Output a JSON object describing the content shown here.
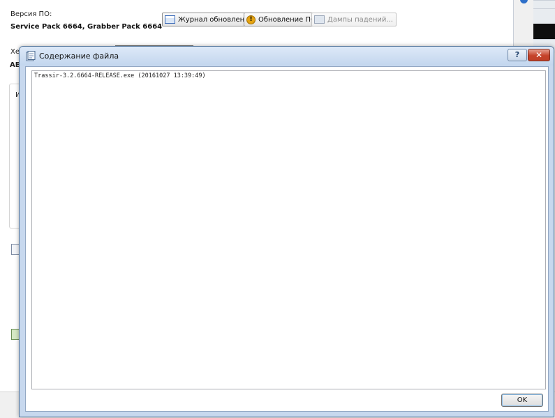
{
  "background": {
    "version_label": "Версия ПО:",
    "version_value": "Service Pack 6664, Grabber Pack 6664",
    "journal_button": "Журнал обновлений",
    "update_button": "Обновление ПО",
    "dumps_button": "Дампы падений...",
    "cut_label_1": "Хе",
    "cut_label_2": "АЕ",
    "cut_label_3": "И"
  },
  "dialog": {
    "title": "Содержание файла",
    "help_label": "?",
    "close_label": "✕",
    "content": "Trassir-3.2.6664-RELEASE.exe (20161027 13:39:49)",
    "ok_label": "OK"
  },
  "colors": {
    "titlebar": "#c7d8ee",
    "close_button": "#c5432a",
    "warning_icon": "#e5a412"
  }
}
